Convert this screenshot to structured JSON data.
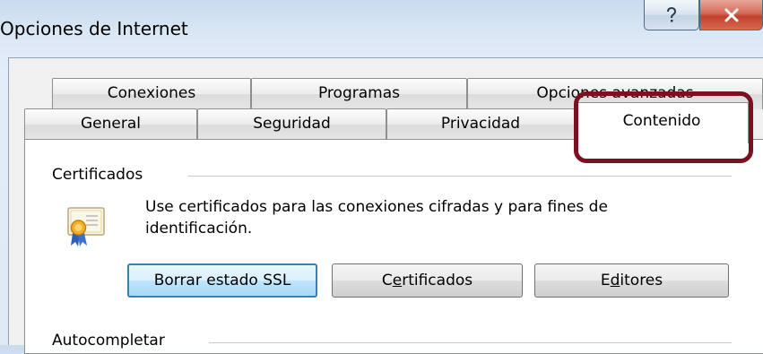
{
  "window": {
    "title": "Opciones de Internet",
    "help_label": "?",
    "close_label": "x"
  },
  "tabs": {
    "row_top": [
      {
        "label": "Conexiones"
      },
      {
        "label": "Programas"
      },
      {
        "label": "Opciones avanzadas"
      }
    ],
    "row_bottom": [
      {
        "label": "General"
      },
      {
        "label": "Seguridad"
      },
      {
        "label": "Privacidad"
      },
      {
        "label": "Contenido",
        "active": true
      }
    ]
  },
  "certificates": {
    "group_title": "Certificados",
    "description": "Use certificados para las conexiones cifradas y para fines de identificación.",
    "buttons": {
      "clear_ssl": "Borrar estado SSL",
      "certificates_pre": "C",
      "certificates_accel": "e",
      "certificates_post": "rtificados",
      "publishers_pre": "E",
      "publishers_accel": "d",
      "publishers_post": "itores"
    }
  },
  "autocomplete": {
    "group_title": "Autocompletar"
  },
  "colors": {
    "highlight_border": "#7b1022",
    "close_button": "#c2412c",
    "focused_button_border": "#3c7fb1"
  }
}
